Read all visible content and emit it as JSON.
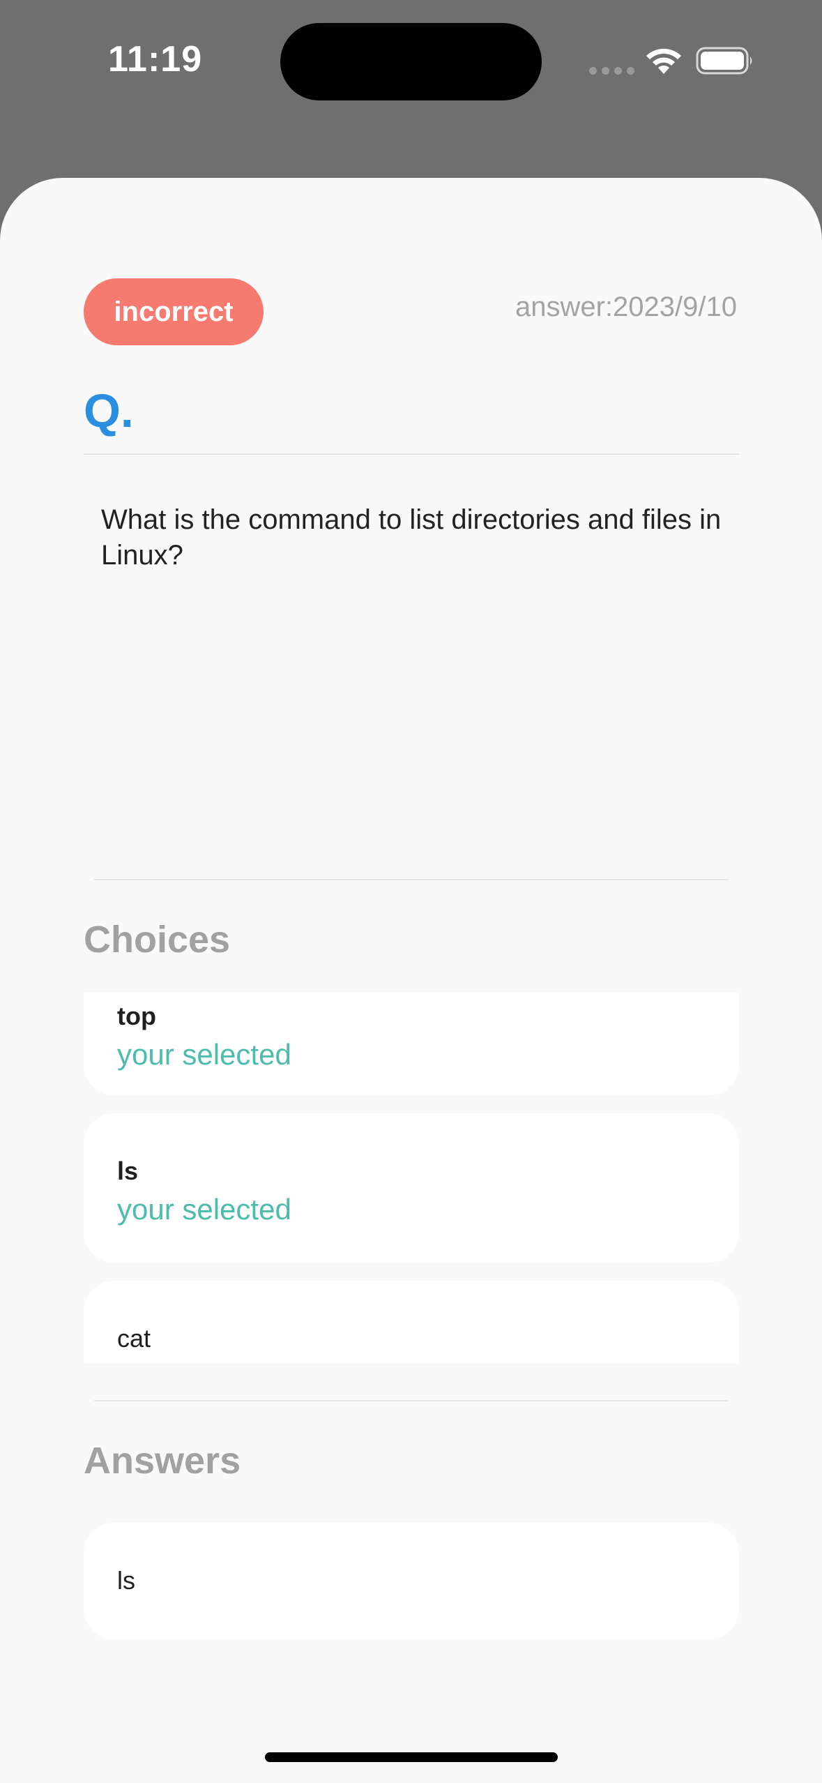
{
  "status_bar": {
    "time": "11:19",
    "icons": [
      "cellular-signal-icon",
      "wifi-icon",
      "battery-icon"
    ]
  },
  "header": {
    "result_badge": "incorrect",
    "answer_date": "answer:2023/9/10"
  },
  "question": {
    "label": "Q.",
    "text": "What is the command to list directories and files in Linux?"
  },
  "choices": {
    "title": "Choices",
    "items": [
      {
        "label": "top",
        "status": "your selected"
      },
      {
        "label": "ls",
        "status": "your selected"
      },
      {
        "label": "cat",
        "status": ""
      }
    ]
  },
  "answers": {
    "title": "Answers",
    "items": [
      {
        "label": "ls"
      }
    ]
  },
  "colors": {
    "incorrect_badge": "#f57b70",
    "question_label": "#2a8fe0",
    "selected_text": "#4cbcab",
    "section_title": "#a1a1a1",
    "backdrop": "#6f6f6f",
    "sheet": "#f9f9f9"
  }
}
